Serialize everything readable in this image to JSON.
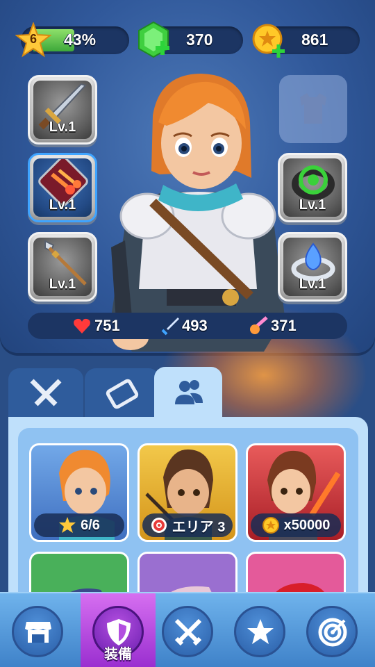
{
  "resources": {
    "level": "6",
    "xp_percent_label": "43%",
    "xp_fraction": 0.43,
    "gems": "370",
    "coins": "861"
  },
  "equipment": {
    "left_slots": [
      {
        "item": "sword",
        "level": "Lv.1"
      },
      {
        "item": "fire-skill",
        "level": "Lv.1"
      },
      {
        "item": "spear",
        "level": "Lv.1"
      }
    ],
    "right_slots": [
      {
        "item": "armor-empty",
        "level": ""
      },
      {
        "item": "green-ring",
        "level": "Lv.1"
      },
      {
        "item": "blue-gem-ring",
        "level": "Lv.1"
      }
    ]
  },
  "stats": {
    "hp": "751",
    "attack": "493",
    "speed": "371"
  },
  "tabs": [
    {
      "icon": "crossed-swords-icon"
    },
    {
      "icon": "scroll-icon"
    },
    {
      "icon": "users-icon",
      "active": true
    }
  ],
  "heroes": [
    {
      "label": "6/6",
      "icon": "star-icon",
      "bg": "#3f6fc0"
    },
    {
      "label": "エリア 3",
      "icon": "target-icon",
      "bg": "#d4941a"
    },
    {
      "label": "x50000",
      "icon": "coin-icon",
      "bg": "#a81e26"
    },
    {
      "label": "",
      "bg": "#49b05a"
    },
    {
      "label": "",
      "bg": "#9a6fd0"
    },
    {
      "label": "",
      "bg": "#e45a9a"
    }
  ],
  "nav": [
    {
      "icon": "shop-icon",
      "label": ""
    },
    {
      "icon": "shield-icon",
      "label": "装備",
      "active": true
    },
    {
      "icon": "crossed-swords-icon",
      "label": ""
    },
    {
      "icon": "star-icon",
      "label": ""
    },
    {
      "icon": "target-icon",
      "label": ""
    }
  ],
  "colors": {
    "panel": "#30589a",
    "xp_fill": "#5cc24a",
    "nav_active": "#b34fe0",
    "lower_panel": "#bfe0fb"
  }
}
